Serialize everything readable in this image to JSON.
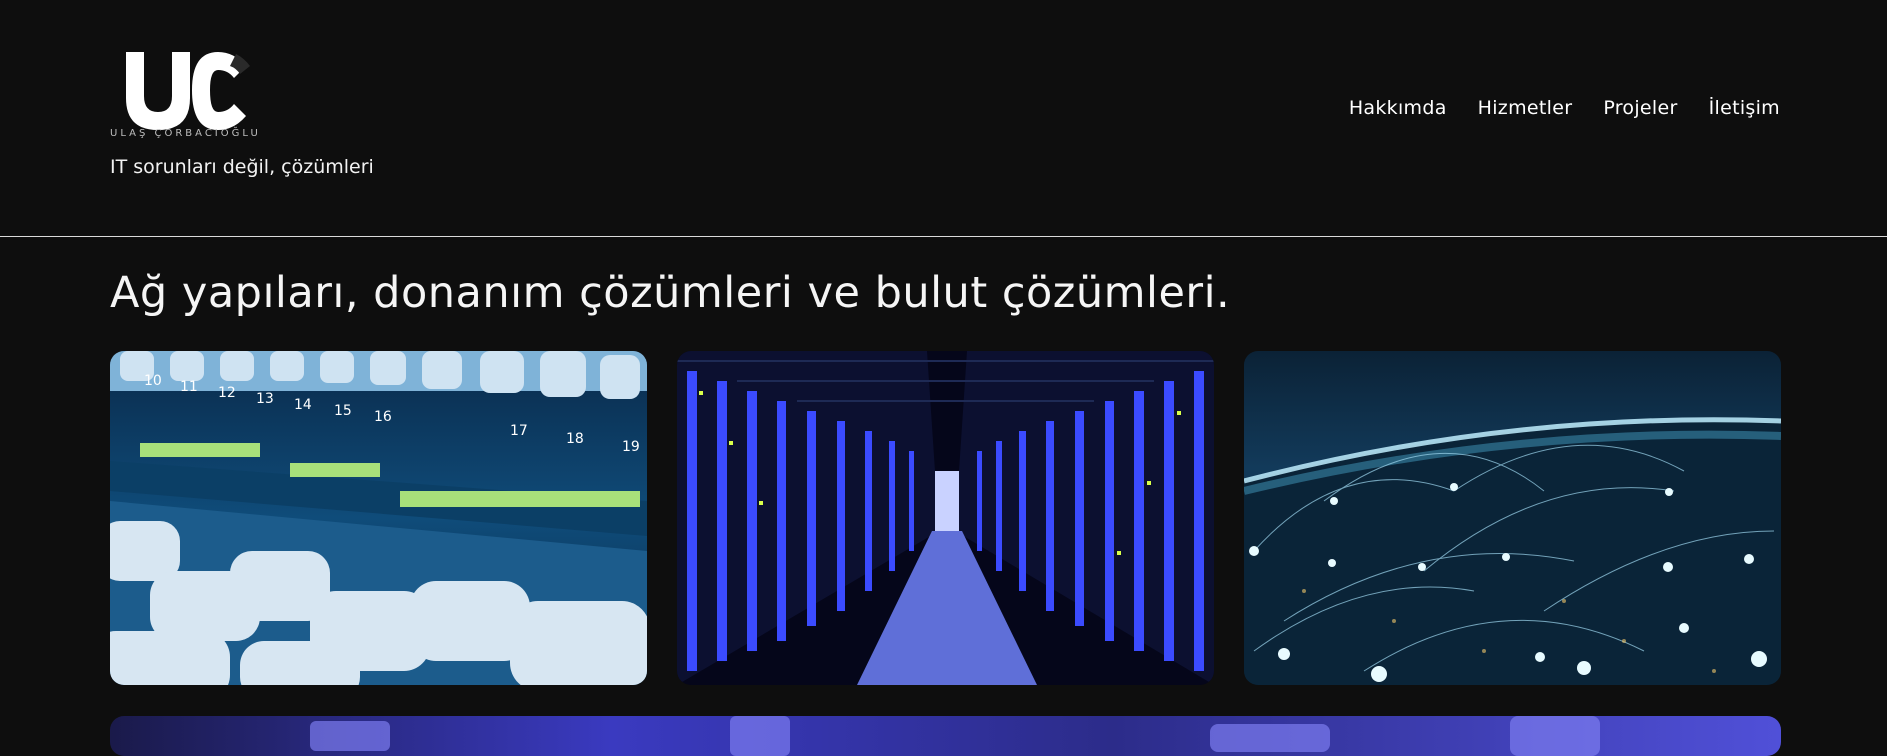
{
  "brand": {
    "logo_letters": "UC",
    "logo_subtitle": "ULAŞ ÇORBACIOĞLU",
    "tagline": "IT sorunları değil, çözümleri"
  },
  "nav": {
    "items": [
      {
        "label": "Hakkımda"
      },
      {
        "label": "Hizmetler"
      },
      {
        "label": "Projeler"
      },
      {
        "label": "İletişim"
      }
    ]
  },
  "main": {
    "headline": "Ağ yapıları, donanım çözümleri ve bulut çözümleri."
  },
  "colors": {
    "background": "#0e0e0e",
    "text": "#ffffff",
    "divider": "#d9d9d9"
  }
}
